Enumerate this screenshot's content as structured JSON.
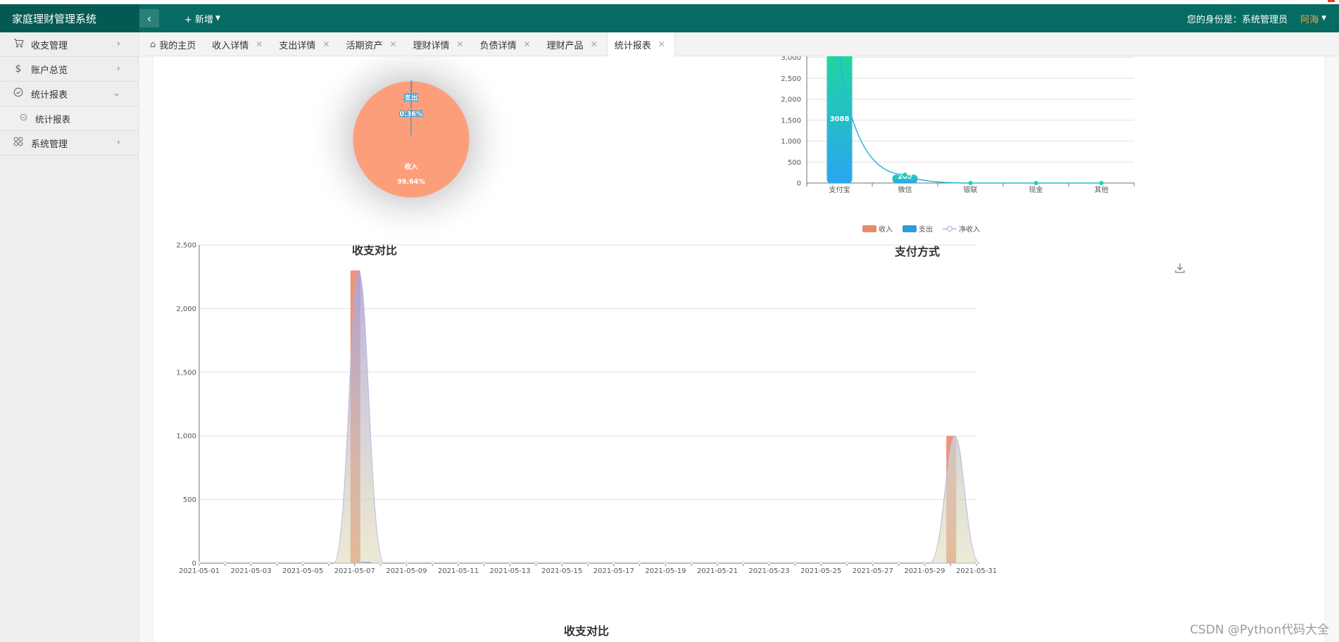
{
  "app": {
    "title": "家庭理财管理系统"
  },
  "header": {
    "collapse_icon": "chevron-left-icon",
    "add_label": "+ 新增",
    "identity_label": "您的身份是：系统管理员",
    "user_name": "阿海"
  },
  "sidebar": {
    "items": [
      {
        "label": "收支管理",
        "icon": "cart-icon"
      },
      {
        "label": "账户总览",
        "icon": "dollar-icon"
      },
      {
        "label": "统计报表",
        "icon": "check-circle-icon",
        "expanded": true
      },
      {
        "label": "统计报表",
        "icon": "circle-icon",
        "sub": true
      },
      {
        "label": "系统管理",
        "icon": "grid-icon"
      }
    ]
  },
  "tabs": [
    {
      "label": "我的主页",
      "closable": false
    },
    {
      "label": "收入详情",
      "closable": true
    },
    {
      "label": "支出详情",
      "closable": true
    },
    {
      "label": "活期资产",
      "closable": true
    },
    {
      "label": "理财详情",
      "closable": true
    },
    {
      "label": "负债详情",
      "closable": true
    },
    {
      "label": "理财产品",
      "closable": true
    },
    {
      "label": "统计报表",
      "closable": true,
      "active": true
    }
  ],
  "chart_data": [
    {
      "type": "pie",
      "title": "收支对比",
      "slices": [
        {
          "name": "收入",
          "percent": 99.64,
          "label": "99.64%",
          "color": "#fd9e7b"
        },
        {
          "name": "支出",
          "percent": 0.36,
          "label": "0.36%",
          "color": "#2f9bd8"
        }
      ]
    },
    {
      "type": "bar",
      "title": "支付方式",
      "categories": [
        "支付宝",
        "微信",
        "银联",
        "现金",
        "其他"
      ],
      "values": [
        3088,
        200,
        0,
        0,
        0
      ],
      "labels": [
        "3088",
        "200",
        "",
        "",
        ""
      ],
      "overlay_line_values": [
        3088,
        200,
        0,
        0,
        0
      ],
      "ylim": [
        0,
        3200
      ],
      "yticks": [
        "0",
        "500",
        "1,000",
        "1,500",
        "2,000",
        "2,500",
        "3,000"
      ],
      "colors": {
        "bar_top": "#1fd6a0",
        "bar_bottom": "#2aa6f0",
        "line": "#2bb4dc",
        "point": "#1fd6a0"
      }
    },
    {
      "type": "bar",
      "title": "收支对比",
      "legend_position": "top-right",
      "x": [
        "2021-05-01",
        "2021-05-02",
        "2021-05-03",
        "2021-05-04",
        "2021-05-05",
        "2021-05-06",
        "2021-05-07",
        "2021-05-08",
        "2021-05-09",
        "2021-05-10",
        "2021-05-11",
        "2021-05-12",
        "2021-05-13",
        "2021-05-14",
        "2021-05-15",
        "2021-05-16",
        "2021-05-17",
        "2021-05-18",
        "2021-05-19",
        "2021-05-20",
        "2021-05-21",
        "2021-05-22",
        "2021-05-23",
        "2021-05-24",
        "2021-05-25",
        "2021-05-26",
        "2021-05-27",
        "2021-05-28",
        "2021-05-29",
        "2021-05-30",
        "2021-05-31"
      ],
      "xtick_labels": [
        "2021-05-01",
        "2021-05-03",
        "2021-05-05",
        "2021-05-07",
        "2021-05-09",
        "2021-05-11",
        "2021-05-13",
        "2021-05-15",
        "2021-05-17",
        "2021-05-19",
        "2021-05-21",
        "2021-05-23",
        "2021-05-25",
        "2021-05-27",
        "2021-05-29",
        "2021-05-31"
      ],
      "ylim": [
        0,
        2500
      ],
      "yticks": [
        "0",
        "500",
        "1,000",
        "1,500",
        "2,000",
        "2,500"
      ],
      "series": [
        {
          "name": "收入",
          "type": "bar",
          "color": "#e98a6c",
          "values": [
            0,
            0,
            0,
            0,
            0,
            0,
            2300,
            0,
            0,
            0,
            0,
            0,
            0,
            0,
            0,
            0,
            0,
            0,
            0,
            0,
            0,
            0,
            0,
            0,
            0,
            0,
            0,
            0,
            0,
            1000,
            0
          ]
        },
        {
          "name": "支出",
          "type": "bar",
          "color": "#2f9bd8",
          "values": [
            0,
            0,
            0,
            0,
            0,
            0,
            11,
            0,
            0,
            0,
            0,
            0,
            0,
            0,
            0,
            0,
            0,
            0,
            0,
            0,
            0,
            0,
            0,
            0,
            0,
            0,
            0,
            0,
            0,
            0,
            0
          ]
        },
        {
          "name": "净收入",
          "type": "line",
          "color": "#b6b0dc",
          "values": [
            0,
            0,
            0,
            0,
            0,
            0,
            2289,
            0,
            0,
            0,
            0,
            0,
            0,
            0,
            0,
            0,
            0,
            0,
            0,
            0,
            0,
            0,
            0,
            0,
            0,
            0,
            0,
            0,
            0,
            1000,
            0
          ]
        }
      ],
      "download_icon": "download-icon"
    }
  ],
  "watermark": "CSDN @Python代码大全"
}
